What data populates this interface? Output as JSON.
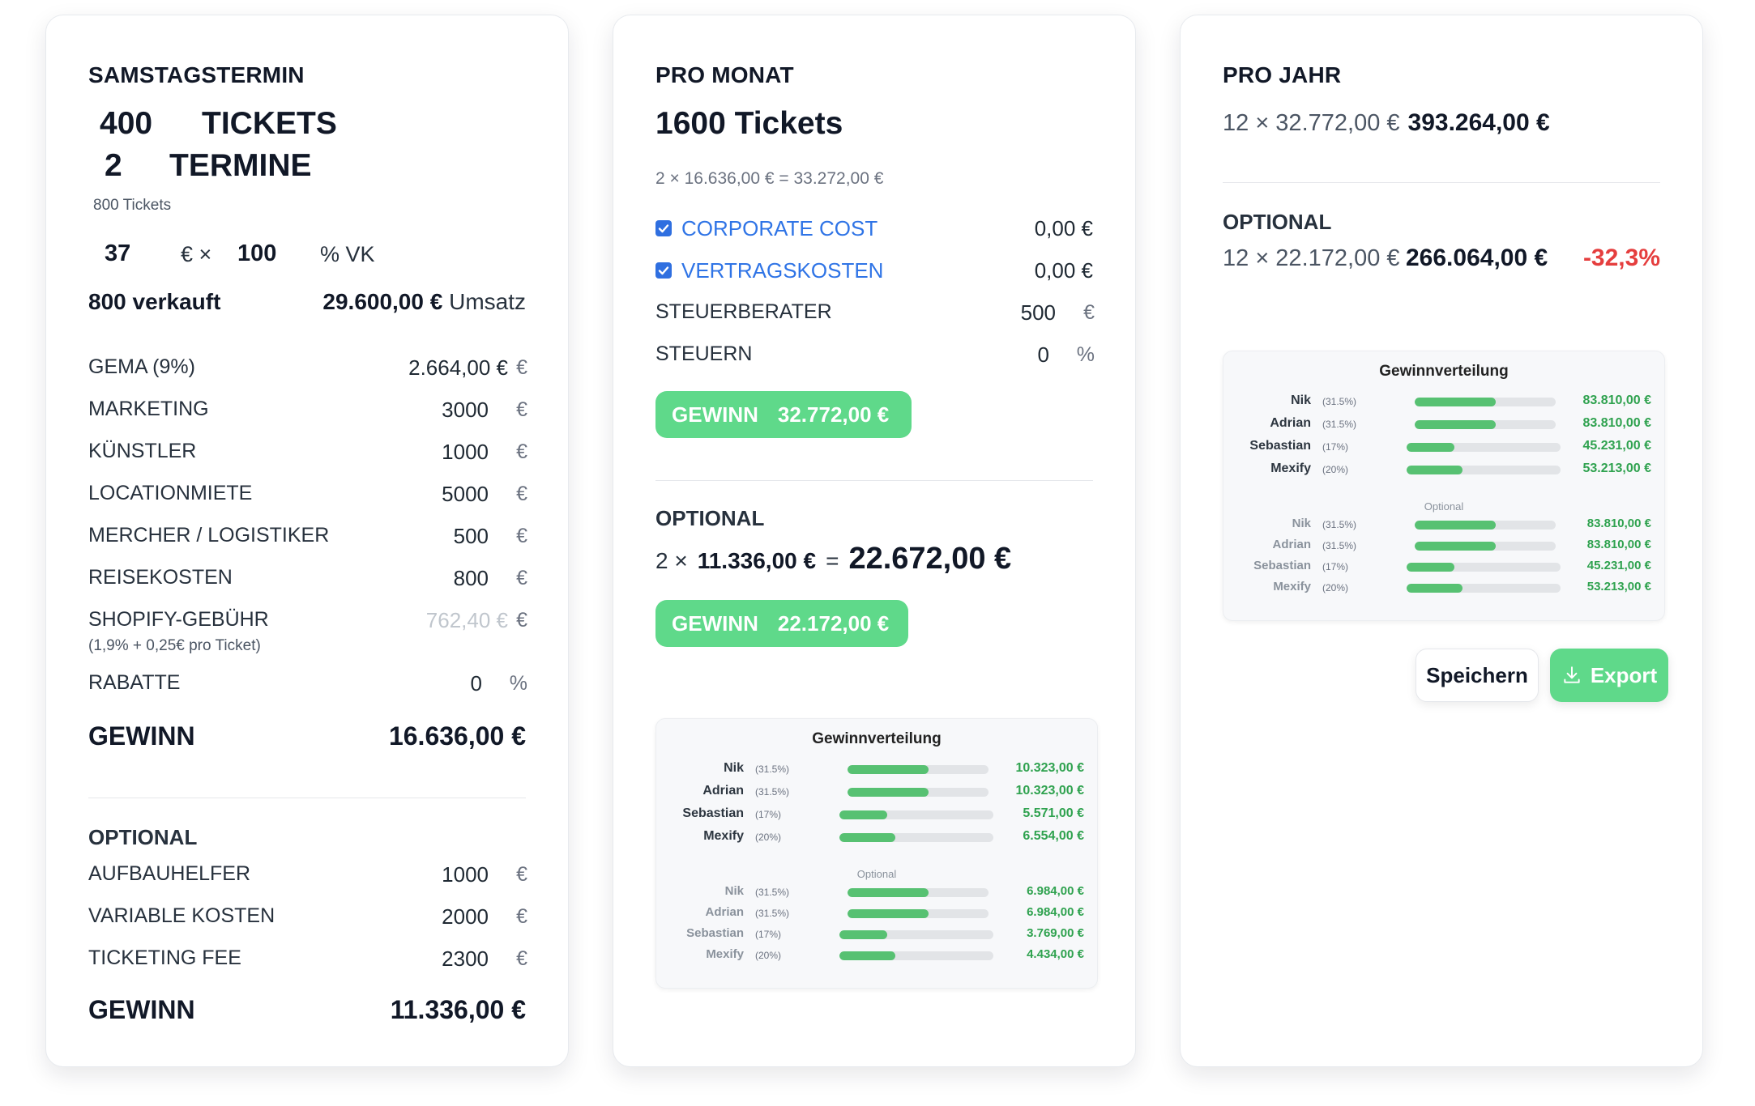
{
  "card1": {
    "title": "SAMSTAGSTERMIN",
    "tickets_count": "400",
    "tickets_label": "TICKETS",
    "termine_count": "2",
    "termine_label": "TERMINE",
    "total_tickets_note": "800 Tickets",
    "price": "37",
    "price_unit": "€ ×",
    "vk_percent": "100",
    "vk_label": "% VK",
    "sold_label": "800 verkauft",
    "revenue_value": "29.600,00 €",
    "revenue_label": "Umsatz",
    "costs": [
      {
        "label": "GEMA (9%)",
        "value": "2.664,00 €",
        "unit": "€"
      },
      {
        "label": "MARKETING",
        "value": "3000",
        "unit": "€"
      },
      {
        "label": "KÜNSTLER",
        "value": "1000",
        "unit": "€"
      },
      {
        "label": "LOCATIONMIETE",
        "value": "5000",
        "unit": "€"
      },
      {
        "label": "MERCHER / LOGISTIKER",
        "value": "500",
        "unit": "€"
      },
      {
        "label": "REISEKOSTEN",
        "value": "800",
        "unit": "€"
      },
      {
        "label": "SHOPIFY-GEBÜHR",
        "value": "762,40 €",
        "unit": "€",
        "note": "(1,9% + 0,25€ pro Ticket)"
      },
      {
        "label": "RABATTE",
        "value": "0",
        "unit": "%"
      }
    ],
    "gewinn_label": "GEWINN",
    "gewinn_value": "16.636,00 €",
    "optional_title": "OPTIONAL",
    "optional_costs": [
      {
        "label": "AUFBAUHELFER",
        "value": "1000",
        "unit": "€"
      },
      {
        "label": "VARIABLE KOSTEN",
        "value": "2000",
        "unit": "€"
      },
      {
        "label": "TICKETING FEE",
        "value": "2300",
        "unit": "€"
      }
    ],
    "optional_gewinn_label": "GEWINN",
    "optional_gewinn_value": "11.336,00 €"
  },
  "card2": {
    "title": "PRO MONAT",
    "tickets_total": "1600 Tickets",
    "calc_line": "2 × 16.636,00 € = 33.272,00 €",
    "checkbox_items": [
      {
        "label": "CORPORATE COST",
        "value": "0,00 €",
        "checked": true
      },
      {
        "label": "VERTRAGSKOSTEN",
        "value": "0,00 €",
        "checked": true
      }
    ],
    "inputs": [
      {
        "label": "STEUERBERATER",
        "value": "500",
        "unit": "€"
      },
      {
        "label": "STEUERN",
        "value": "0",
        "unit": "%"
      }
    ],
    "gewinn_label": "GEWINN",
    "gewinn_value": "32.772,00 €",
    "optional_title": "OPTIONAL",
    "optional_prefix": "2 ×",
    "optional_base": "11.336,00 €",
    "optional_eq": "=",
    "optional_result": "22.672,00 €",
    "optional_gewinn_label": "GEWINN",
    "optional_gewinn_value": "22.172,00 €",
    "distribution": {
      "title": "Gewinnverteilung",
      "rows": [
        {
          "name": "Nik",
          "pct": "(31.5%)",
          "share": 0.315,
          "value": "10.323,00 €"
        },
        {
          "name": "Adrian",
          "pct": "(31.5%)",
          "share": 0.315,
          "value": "10.323,00 €"
        },
        {
          "name": "Sebastian",
          "pct": "(17%)",
          "share": 0.17,
          "value": "5.571,00 €"
        },
        {
          "name": "Mexify",
          "pct": "(20%)",
          "share": 0.2,
          "value": "6.554,00 €"
        }
      ],
      "optional_label": "Optional",
      "optional_rows": [
        {
          "name": "Nik",
          "pct": "(31.5%)",
          "share": 0.315,
          "value": "6.984,00 €"
        },
        {
          "name": "Adrian",
          "pct": "(31.5%)",
          "share": 0.315,
          "value": "6.984,00 €"
        },
        {
          "name": "Sebastian",
          "pct": "(17%)",
          "share": 0.17,
          "value": "3.769,00 €"
        },
        {
          "name": "Mexify",
          "pct": "(20%)",
          "share": 0.2,
          "value": "4.434,00 €"
        }
      ]
    }
  },
  "card3": {
    "title": "PRO JAHR",
    "calc_prefix": "12 × 32.772,00 €",
    "calc_result": "393.264,00 €",
    "optional_title": "OPTIONAL",
    "optional_prefix": "12 × 22.172,00 €",
    "optional_result": "266.064,00 €",
    "optional_delta": "-32,3%",
    "distribution": {
      "title": "Gewinnverteilung",
      "rows": [
        {
          "name": "Nik",
          "pct": "(31.5%)",
          "share": 0.315,
          "value": "83.810,00 €"
        },
        {
          "name": "Adrian",
          "pct": "(31.5%)",
          "share": 0.315,
          "value": "83.810,00 €"
        },
        {
          "name": "Sebastian",
          "pct": "(17%)",
          "share": 0.17,
          "value": "45.231,00 €"
        },
        {
          "name": "Mexify",
          "pct": "(20%)",
          "share": 0.2,
          "value": "53.213,00 €"
        }
      ],
      "optional_label": "Optional",
      "optional_rows": [
        {
          "name": "Nik",
          "pct": "(31.5%)",
          "share": 0.315,
          "value": "83.810,00 €"
        },
        {
          "name": "Adrian",
          "pct": "(31.5%)",
          "share": 0.315,
          "value": "83.810,00 €"
        },
        {
          "name": "Sebastian",
          "pct": "(17%)",
          "share": 0.17,
          "value": "45.231,00 €"
        },
        {
          "name": "Mexify",
          "pct": "(20%)",
          "share": 0.2,
          "value": "53.213,00 €"
        }
      ]
    },
    "save_label": "Speichern",
    "export_label": "Export"
  },
  "colors": {
    "accent_green": "#5fd98a",
    "value_green": "#2fa24f",
    "link_blue": "#2f74e6",
    "negative_red": "#e53e3e"
  }
}
